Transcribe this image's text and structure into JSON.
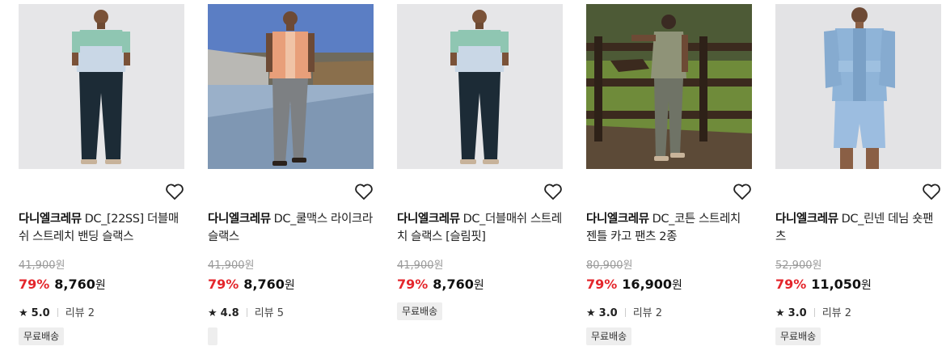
{
  "products": [
    {
      "brand": "다니엘크레뮤",
      "name": "DC_[22SS] 더블매쉬 스트레치 밴딩 슬랙스",
      "original_price": "41,900",
      "discount": "79%",
      "price": "8,760",
      "rating": "5.0",
      "reviews": "리뷰 2",
      "badge": "무료배송",
      "image": "model-striped-polo-navy-slacks",
      "colors": {
        "top_upper": "#8fc6b2",
        "top_lower": "#c9d7e6",
        "pants": "#1c2b36",
        "bg": "#e6e6e8"
      }
    },
    {
      "brand": "다니엘크레뮤",
      "name": "DC_쿨맥스 라이크라 슬랙스",
      "original_price": "41,900",
      "discount": "79%",
      "price": "8,760",
      "rating": "4.8",
      "reviews": "리뷰 5",
      "badge": "",
      "image": "model-outdoor-orange-knit-grey-slacks",
      "colors": {
        "top": "#e89f7a",
        "pants": "#7d8083",
        "sky": "#5b7ec4",
        "ground": "#9ab0c9"
      }
    },
    {
      "brand": "다니엘크레뮤",
      "name": "DC_더블매쉬 스트레치 슬랙스 [슬림핏]",
      "original_price": "41,900",
      "discount": "79%",
      "price": "8,760",
      "rating": "",
      "reviews": "",
      "badge": "무료배송",
      "image": "model-striped-polo-navy-slim-slacks",
      "colors": {
        "top_upper": "#8fc6b2",
        "top_lower": "#c9d7e6",
        "pants": "#1c2b36",
        "bg": "#e6e6e8"
      }
    },
    {
      "brand": "다니엘크레뮤",
      "name": "DC_코튼 스트레치 젠틀 카고 팬츠 2종",
      "original_price": "80,900",
      "discount": "79%",
      "price": "16,900",
      "rating": "3.0",
      "reviews": "리뷰 2",
      "badge": "무료배송",
      "image": "model-fence-field-khaki-cargo",
      "colors": {
        "top": "#8f9378",
        "pants": "#6f7366",
        "grass": "#6f8b3a",
        "fence": "#3b2a1e"
      }
    },
    {
      "brand": "다니엘크레뮤",
      "name": "DC_린넨 데님 숏팬츠",
      "original_price": "52,900",
      "discount": "79%",
      "price": "11,050",
      "rating": "3.0",
      "reviews": "리뷰 2",
      "badge": "무료배송",
      "image": "model-denim-jacket-shorts",
      "colors": {
        "denim": "#8fb4d8",
        "bg": "#e3e3e5"
      }
    }
  ],
  "currency": "원",
  "icons": {
    "wishlist": "heart-outline-icon",
    "rating": "star-icon"
  },
  "theme": {
    "discount_color": "#e4262c",
    "badge_bg": "#eeeeee"
  }
}
